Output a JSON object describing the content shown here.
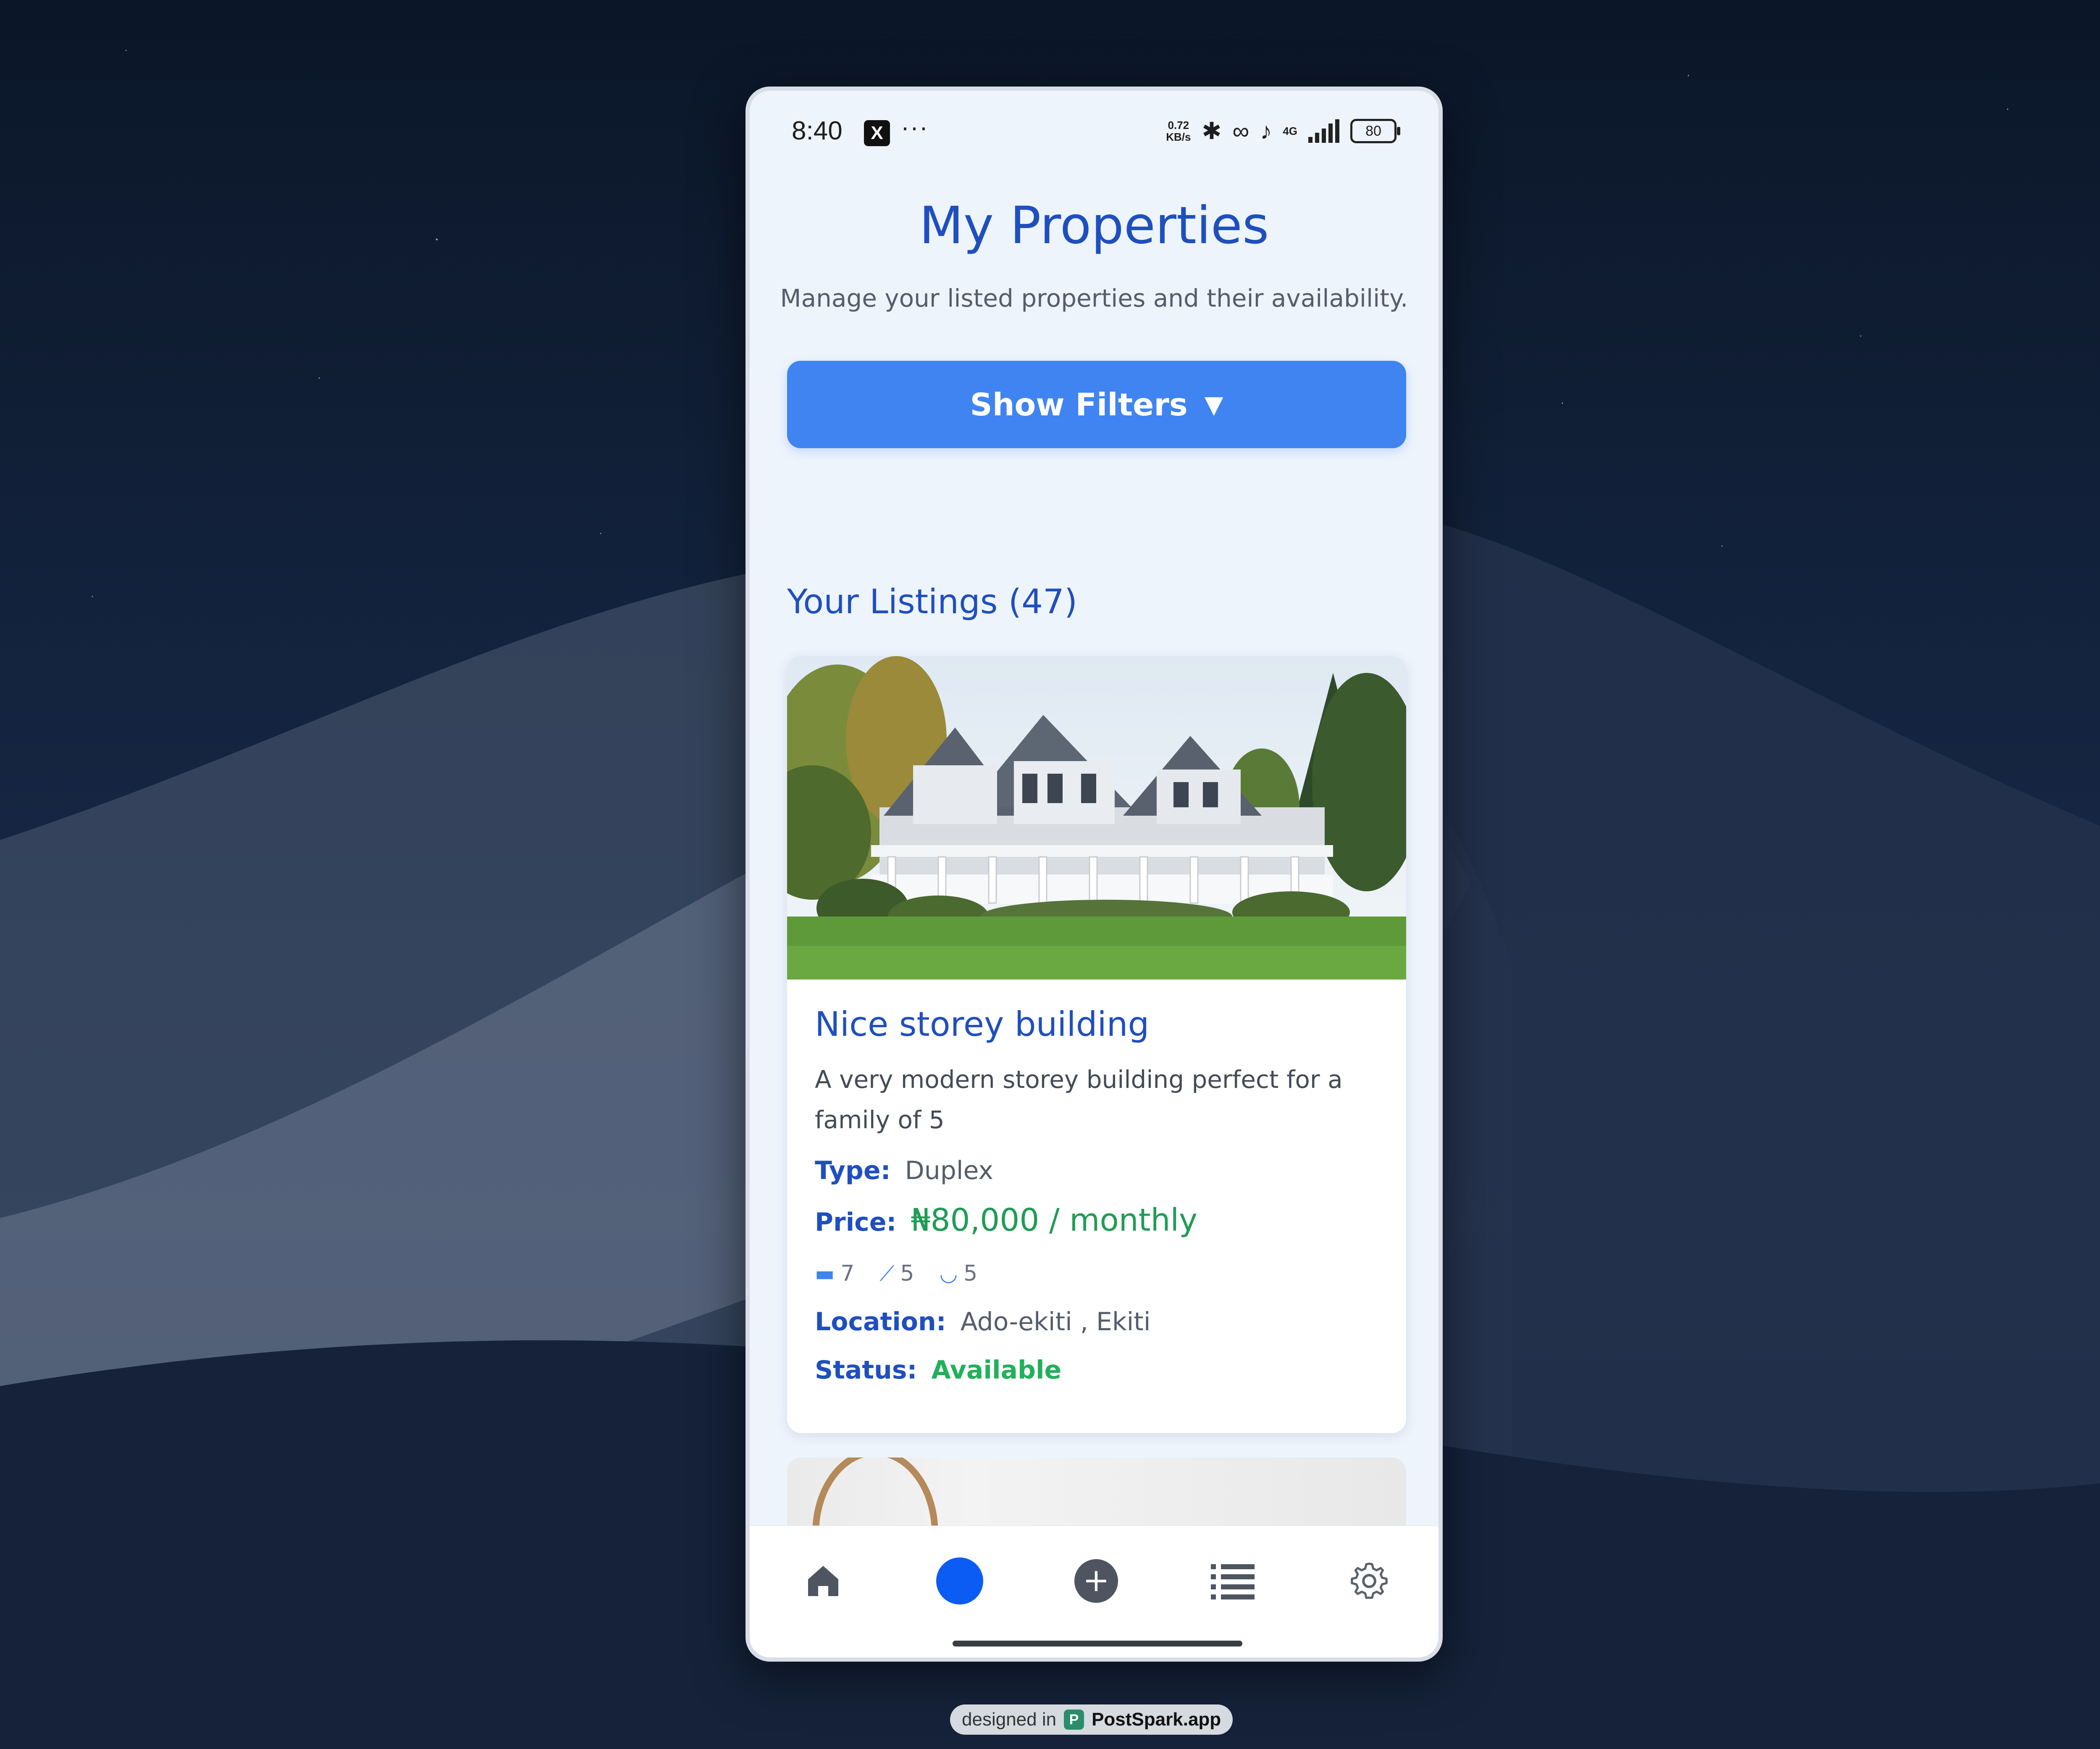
{
  "status_bar": {
    "time": "8:40",
    "x_icon": "X",
    "more": "···",
    "net_speed_value": "0.72",
    "net_speed_unit": "KB/s",
    "network": "4G",
    "battery": "80"
  },
  "header": {
    "title": "My Properties",
    "subtitle": "Manage your listed properties and their availability."
  },
  "filters_button": {
    "label": "Show Filters",
    "icon": "▼"
  },
  "listings": {
    "heading": "Your Listings (47)",
    "items": [
      {
        "title": "Nice storey building",
        "description": "A very modern storey building perfect for a family of 5",
        "type_label": "Type:",
        "type": "Duplex",
        "price_label": "Price:",
        "price": "₦80,000 / monthly",
        "bedrooms": "7",
        "bathrooms": "5",
        "toilets": "5",
        "location_label": "Location:",
        "location": "Ado-ekiti , Ekiti",
        "status_label": "Status:",
        "status": "Available"
      }
    ]
  },
  "bottom_nav": {
    "items": [
      "home-icon",
      "active-dot",
      "add-icon",
      "list-icon",
      "settings-icon"
    ],
    "active_color": "#0a5cf5"
  },
  "watermark": {
    "prefix": "designed in",
    "logo": "P",
    "brand": "PostSpark.app"
  },
  "colors": {
    "accent": "#3f84f0",
    "title": "#1f4fbf",
    "price": "#1f9c55",
    "status_available": "#22b05a"
  }
}
